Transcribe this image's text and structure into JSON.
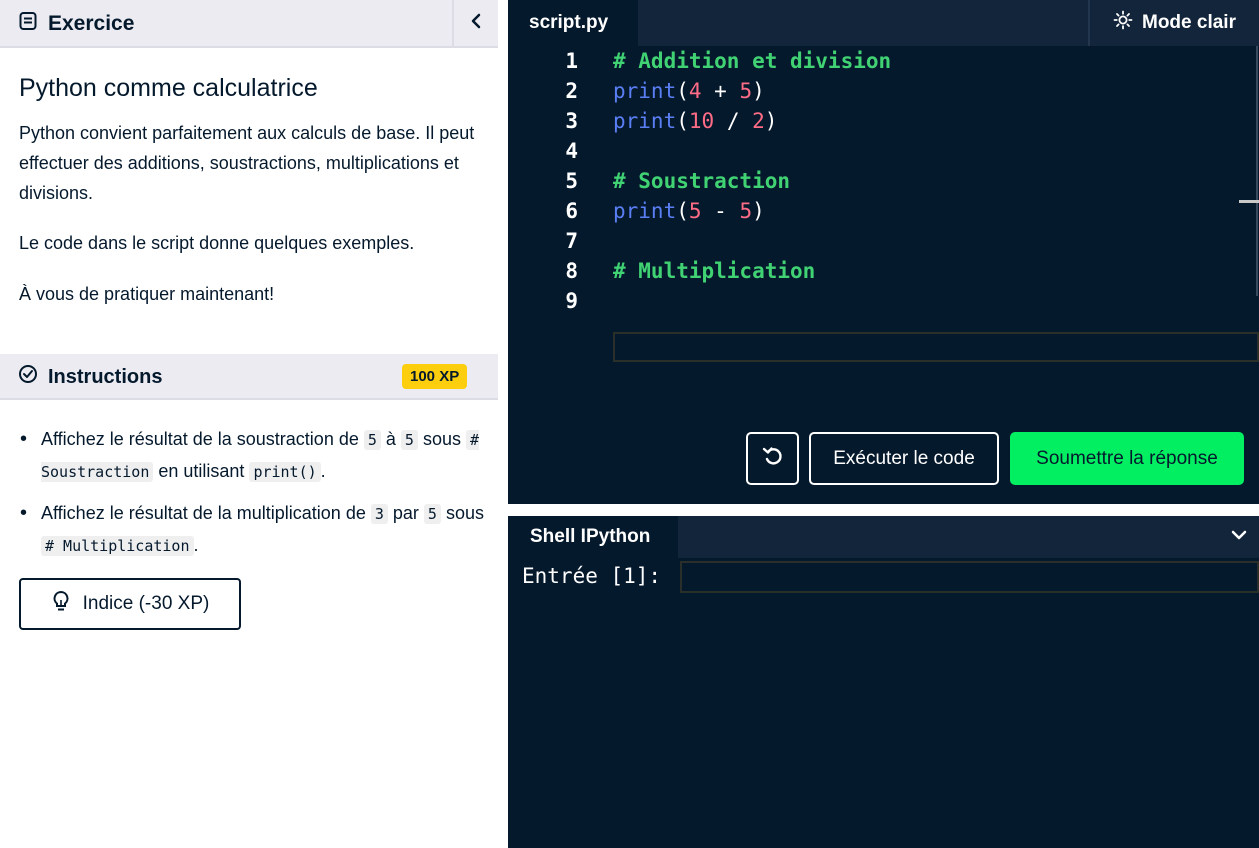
{
  "exercise": {
    "header_label": "Exercice",
    "lesson_title": "Python comme calculatrice",
    "paragraphs": [
      "Python convient parfaitement aux calculs de base. Il peut effectuer des additions, soustractions, multiplications et divisions.",
      "Le code dans le script donne quelques exemples.",
      "À vous de pratiquer maintenant!"
    ]
  },
  "instructions": {
    "header_label": "Instructions",
    "xp_badge": "100 XP",
    "items": [
      {
        "t1": "Affichez le résultat de la soustraction de ",
        "c1": "5",
        "t2": " à ",
        "c2": "5",
        "t3": " sous ",
        "c3": "# Soustraction",
        "t4": " en utilisant ",
        "c4": "print()",
        "t5": "."
      },
      {
        "t1": "Affichez le résultat de la multiplication de ",
        "c1": "3",
        "t2": " par ",
        "c2": "5",
        "t3": " sous ",
        "c3": "# Multiplication",
        "t4": "."
      }
    ],
    "hint_label": "Indice (-30 XP)"
  },
  "editor": {
    "tab_label": "script.py",
    "mode_label": "Mode clair",
    "lines": [
      {
        "num": "1",
        "comment": "# Addition et division"
      },
      {
        "num": "2",
        "fn": "print",
        "open": "(",
        "a": "4",
        "op": " + ",
        "b": "5",
        "close": ")"
      },
      {
        "num": "3",
        "fn": "print",
        "open": "(",
        "a": "10",
        "op": " / ",
        "b": "2",
        "close": ")"
      },
      {
        "num": "4"
      },
      {
        "num": "5",
        "comment": "# Soustraction"
      },
      {
        "num": "6",
        "fn": "print",
        "open": "(",
        "a": "5",
        "op": " - ",
        "b": "5",
        "close": ")"
      },
      {
        "num": "7"
      },
      {
        "num": "8",
        "comment": "# Multiplication"
      },
      {
        "num": "9"
      }
    ],
    "run_label": "Exécuter le code",
    "submit_label": "Soumettre la réponse"
  },
  "shell": {
    "tab_label": "Shell IPython",
    "prompt": "Entrée [1]:",
    "input_value": ""
  },
  "colors": {
    "dark_bg": "#05192d",
    "tab_bar": "#13253a",
    "green_accent": "#03ef62",
    "xp_yellow": "#fcce0d",
    "comment_green": "#40d273",
    "function_blue": "#5a7ff5",
    "number_pink": "#ff6c86"
  }
}
